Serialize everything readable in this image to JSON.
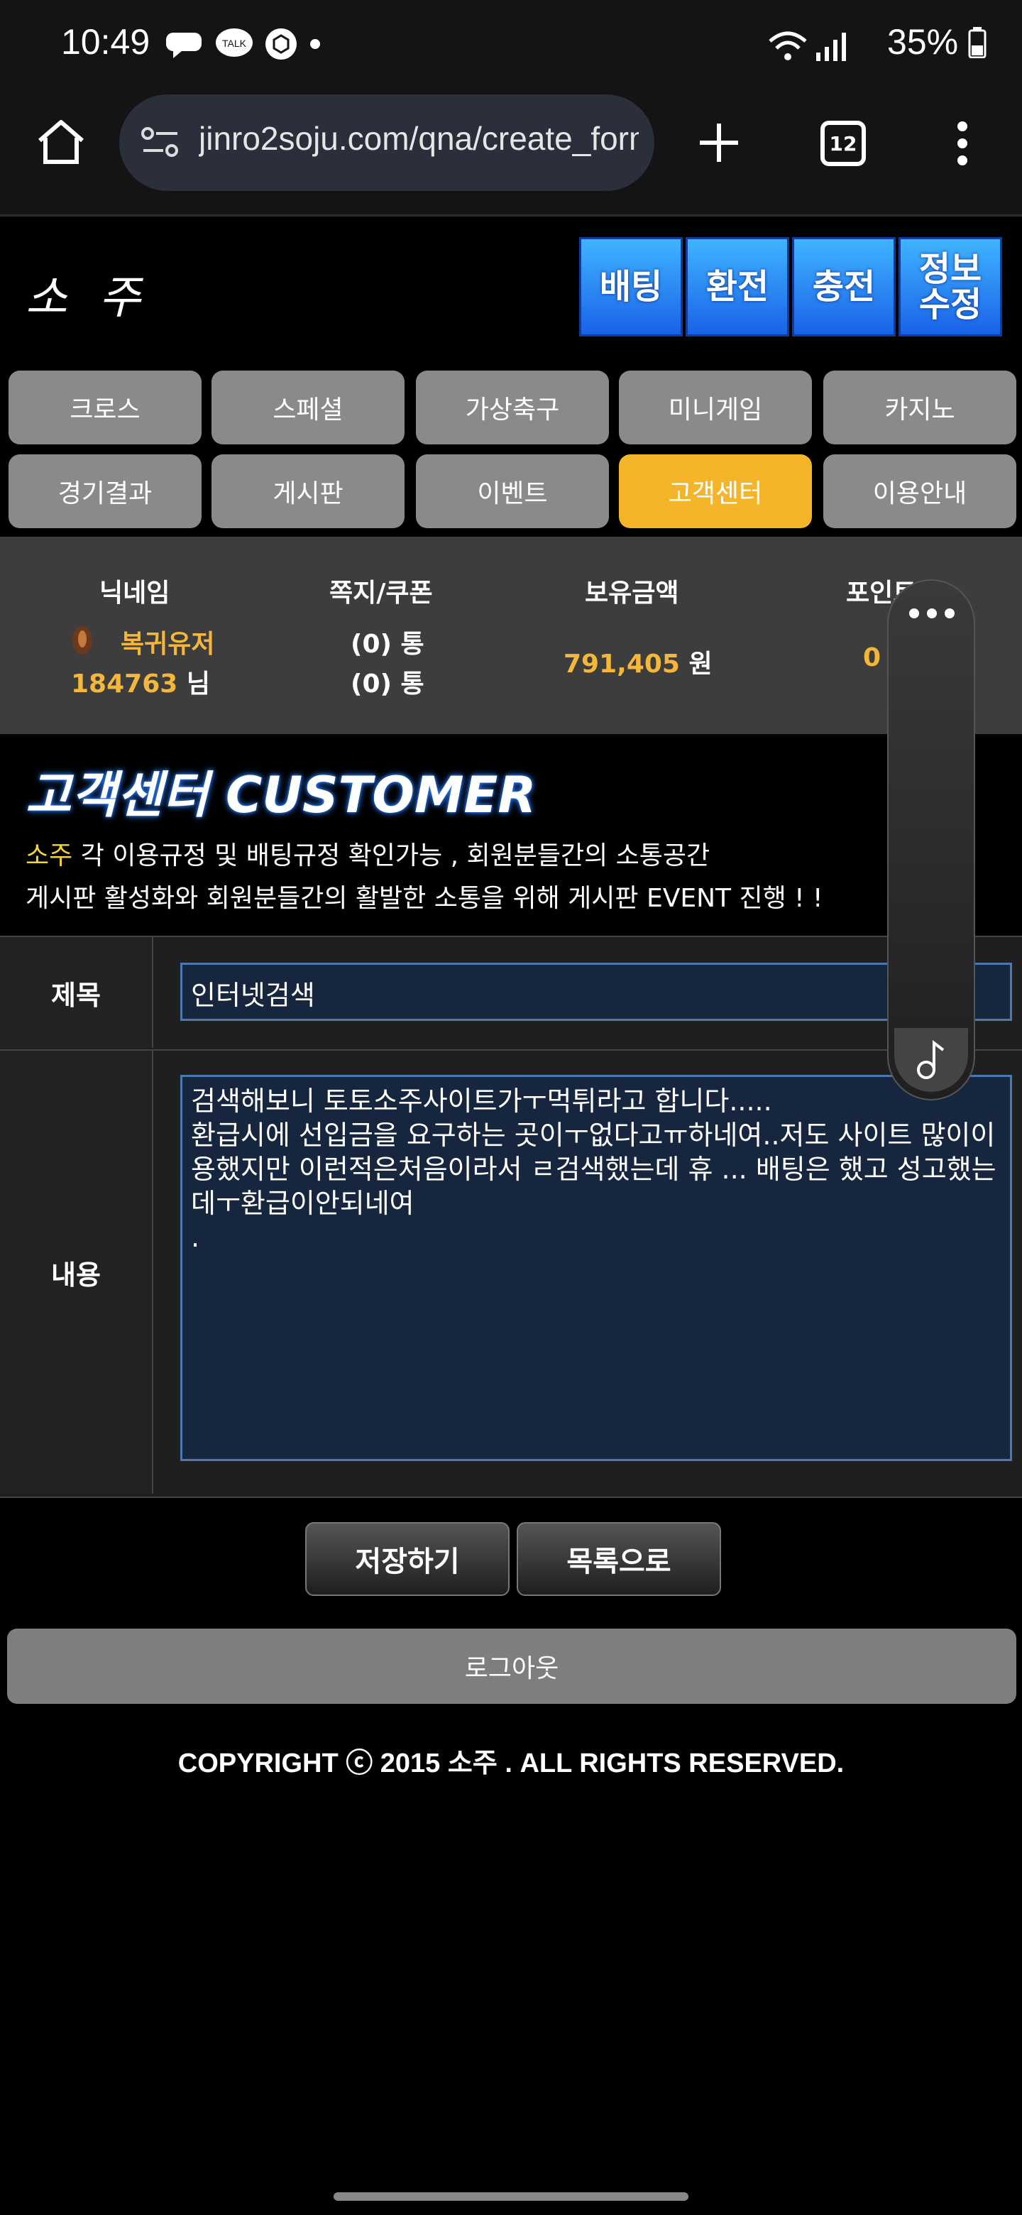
{
  "status_bar": {
    "time": "10:49",
    "battery": "35%",
    "notification_icons": [
      "chat-bubble-icon",
      "talk-icon",
      "box-icon",
      "dot-icon"
    ]
  },
  "browser": {
    "url": "jinro2soju.com/qna/create_form",
    "tab_count": "12"
  },
  "header": {
    "logo": "소 주",
    "buttons": [
      "배팅",
      "환전",
      "충전",
      "정보\n수정"
    ]
  },
  "nav": {
    "row1": [
      "크로스",
      "스페셜",
      "가상축구",
      "미니게임",
      "카지노"
    ],
    "row2": [
      "경기결과",
      "게시판",
      "이벤트",
      "고객센터",
      "이용안내"
    ],
    "active": "고객센터"
  },
  "user_info": {
    "headers": [
      "닉네임",
      "쪽지/쿠폰",
      "보유금액",
      "포인트"
    ],
    "nickname": "복귀유저",
    "user_id": "184763",
    "user_suffix": "님",
    "messages": "(0) 통",
    "coupons": "(0) 통",
    "balance": "791,405",
    "balance_unit": "원",
    "points": "0"
  },
  "customer": {
    "title": "고객센터 CUSTOMER",
    "desc_highlight": "소주",
    "desc_line1": " 각 이용규정 및 배팅규정 확인가능 , 회원분들간의 소통공간",
    "desc_line2": "게시판 활성화와 회원분들간의 활발한 소통을 위해 게시판 EVENT 진행 ! !"
  },
  "form": {
    "subject_label": "제목",
    "subject_value": "인터넷검색",
    "content_label": "내용",
    "content_value": "검색해보니 토토소주사이트가ㅜ먹튀라고 합니다.....\n환급시에 선입금을 요구하는 곳이ㅜ없다고ㅠ하네여..저도 사이트 많이이용했지만 이런적은처음이라서 ㄹ검색했는데 휴 ... 배팅은 했고 성고했는데ㅜ환급이안되네여\n."
  },
  "actions": {
    "save": "저장하기",
    "list": "목록으로",
    "logout": "로그아웃"
  },
  "footer": {
    "copyright": "COPYRIGHT ⓒ 2015 소주 . ALL RIGHTS RESERVED."
  },
  "colors": {
    "accent_gold": "#f4b63b",
    "nav_active": "#f5b52a",
    "header_button_blue": "#1a62e8",
    "field_bg": "#16263f"
  }
}
